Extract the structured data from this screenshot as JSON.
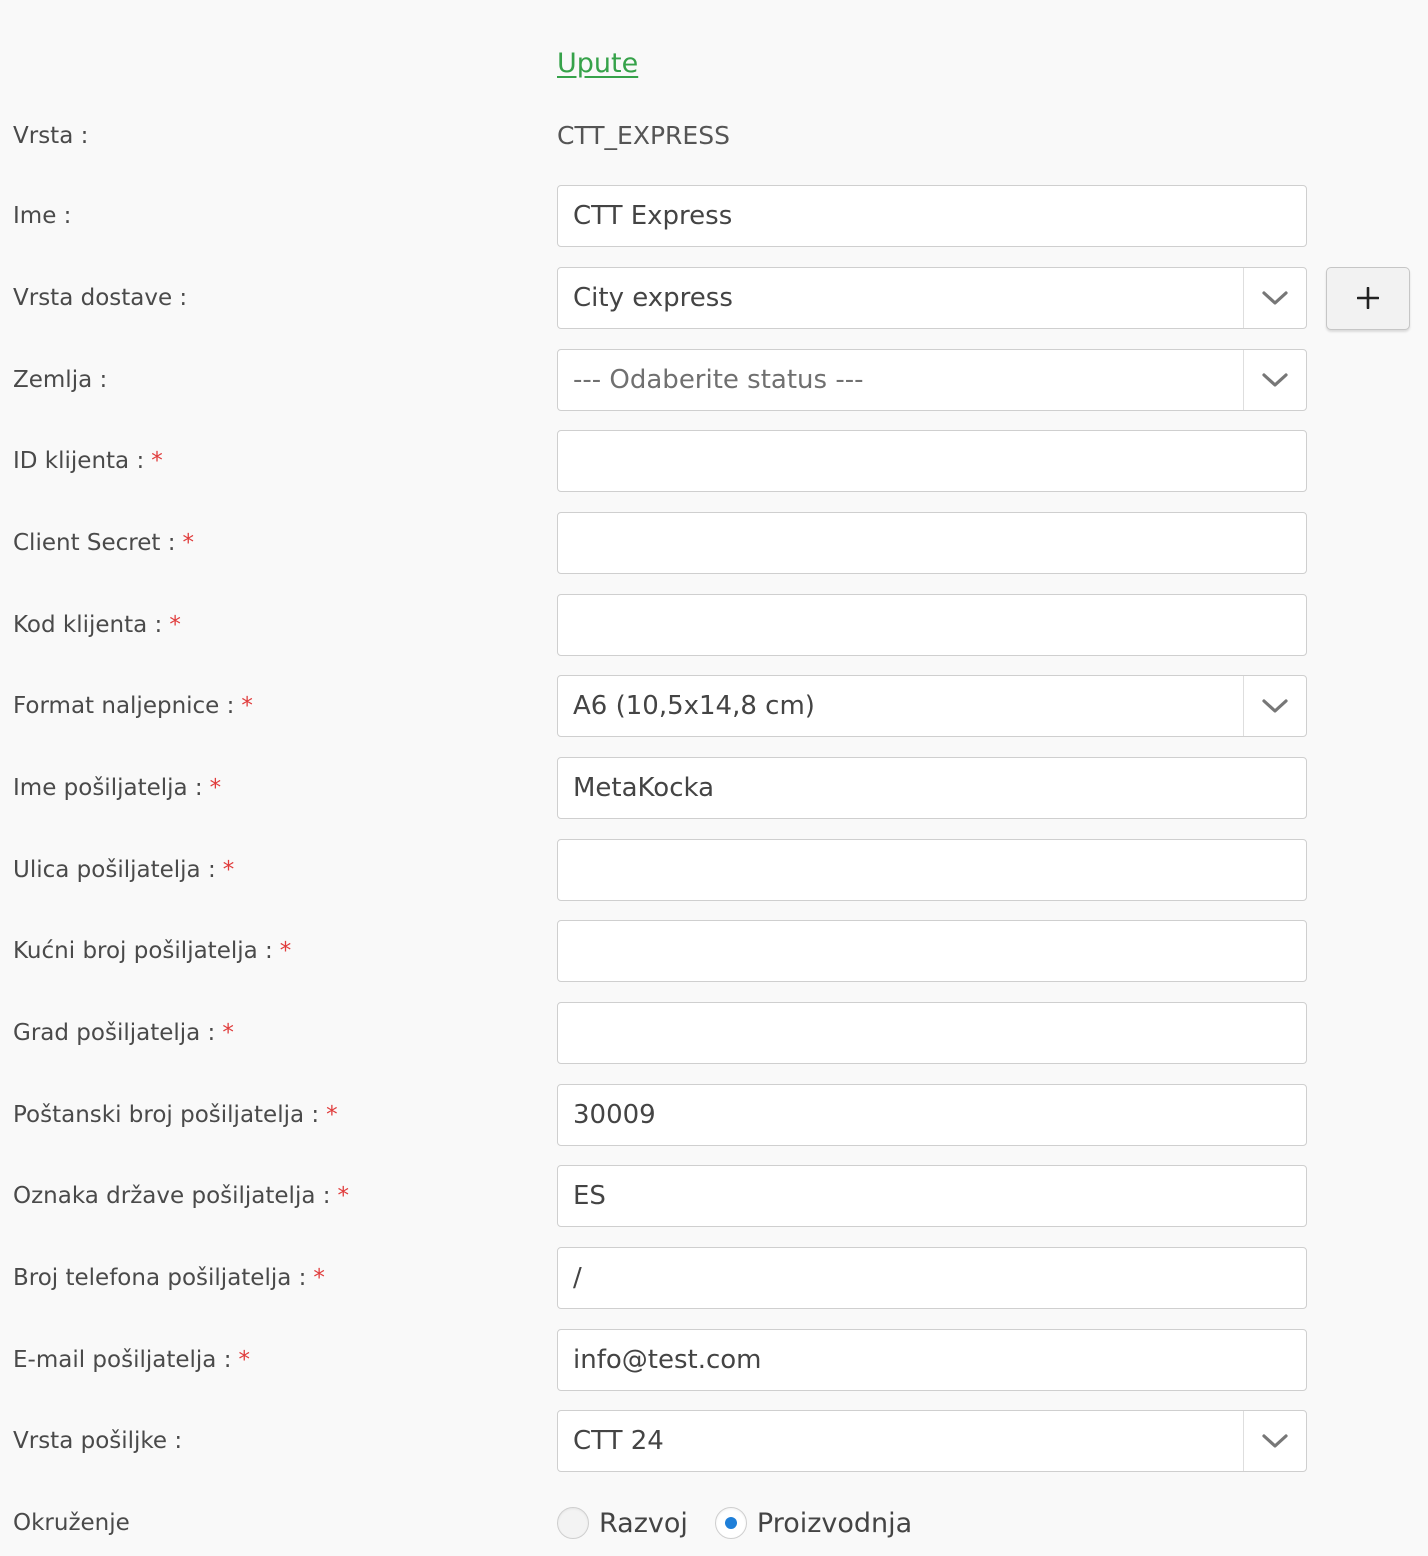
{
  "instructions_link": "Upute",
  "fields": {
    "vrsta": {
      "label": "Vrsta :",
      "value": "CTT_EXPRESS"
    },
    "ime": {
      "label": "Ime :",
      "value": "CTT Express"
    },
    "vrsta_dostave": {
      "label": "Vrsta dostave :",
      "value": "City express",
      "add_label": "+"
    },
    "zemlja": {
      "label": "Zemlja :",
      "placeholder": "--- Odaberite status ---"
    },
    "id_klijenta": {
      "label": "ID klijenta :",
      "required": "*",
      "value": ""
    },
    "client_secret": {
      "label": "Client Secret :",
      "required": "*",
      "value": ""
    },
    "kod_klijenta": {
      "label": "Kod klijenta :",
      "required": "*",
      "value": ""
    },
    "format_naljepnice": {
      "label": "Format naljepnice :",
      "required": "*",
      "value": "A6 (10,5x14,8 cm)"
    },
    "ime_posiljatelja": {
      "label": "Ime pošiljatelja :",
      "required": "*",
      "value": "MetaKocka"
    },
    "ulica_posiljatelja": {
      "label": "Ulica pošiljatelja :",
      "required": "*",
      "value": ""
    },
    "kucni_broj": {
      "label": "Kućni broj pošiljatelja :",
      "required": "*",
      "value": ""
    },
    "grad_posiljatelja": {
      "label": "Grad pošiljatelja :",
      "required": "*",
      "value": ""
    },
    "postanski_broj": {
      "label": "Poštanski broj pošiljatelja :",
      "required": "*",
      "value": "30009"
    },
    "oznaka_drzave": {
      "label": "Oznaka države pošiljatelja :",
      "required": "*",
      "value": "ES"
    },
    "broj_telefona": {
      "label": "Broj telefona pošiljatelja :",
      "required": "*",
      "value": "/"
    },
    "email_posiljatelja": {
      "label": "E-mail pošiljatelja :",
      "required": "*",
      "value": "info@test.com"
    },
    "vrsta_posiljke": {
      "label": "Vrsta pošiljke :",
      "value": "CTT 24"
    },
    "okruzenje": {
      "label": "Okruženje",
      "options": [
        {
          "label": "Razvoj",
          "checked": false
        },
        {
          "label": "Proizvodnja",
          "checked": true
        }
      ]
    }
  },
  "colors": {
    "link": "#36a24a",
    "required": "#e03c3c",
    "radio_selected": "#1f7fd8"
  },
  "icons": {
    "select_arrow": "chevron-down-icon",
    "add": "plus-icon"
  }
}
